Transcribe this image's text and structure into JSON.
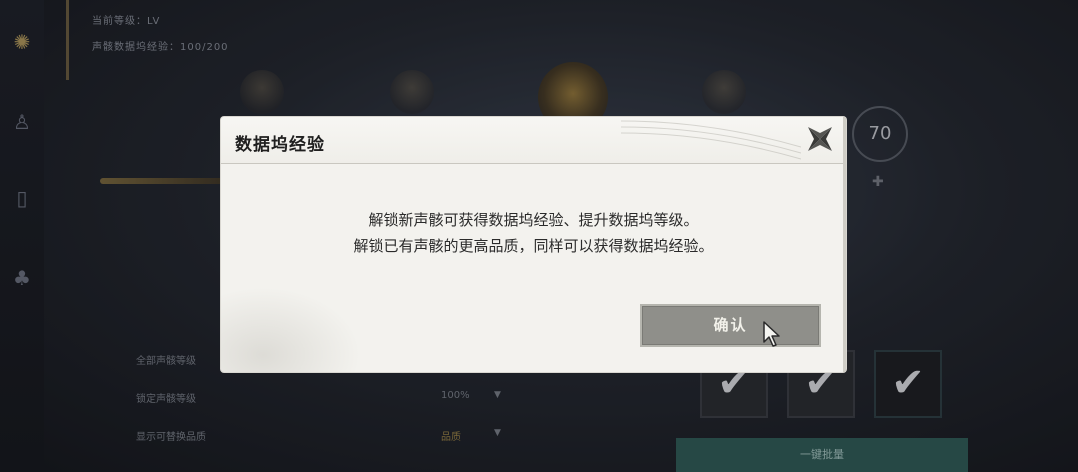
{
  "background": {
    "stats": [
      {
        "label": "当前等级：LV"
      },
      {
        "label": "声骸数据坞经验：100/200"
      }
    ],
    "level": "70",
    "settings": [
      {
        "label": "全部声骸等级",
        "value": ""
      },
      {
        "label": "锁定声骸等级",
        "value": "100%"
      },
      {
        "label": "显示可替换品质",
        "value": "品质"
      },
      {
        "label": "一键批量",
        "value": ""
      }
    ],
    "teal_button_label": "一键批量"
  },
  "modal": {
    "title": "数据坞经验",
    "message_line1": "解锁新声骸可获得数据坞经验、提升数据坞等级。",
    "message_line2": "解锁已有声骸的更高品质，同样可以获得数据坞经验。",
    "confirm_label": "确认"
  },
  "icons": {
    "close": "close-icon",
    "cursor": "mouse-cursor-icon",
    "check": "checkmark-icon"
  },
  "colors": {
    "modal_bg": "#f3f2ee",
    "confirm_bg": "#8f8f8a",
    "accent_gold": "#b39a5c",
    "teal": "#2f5d57"
  }
}
